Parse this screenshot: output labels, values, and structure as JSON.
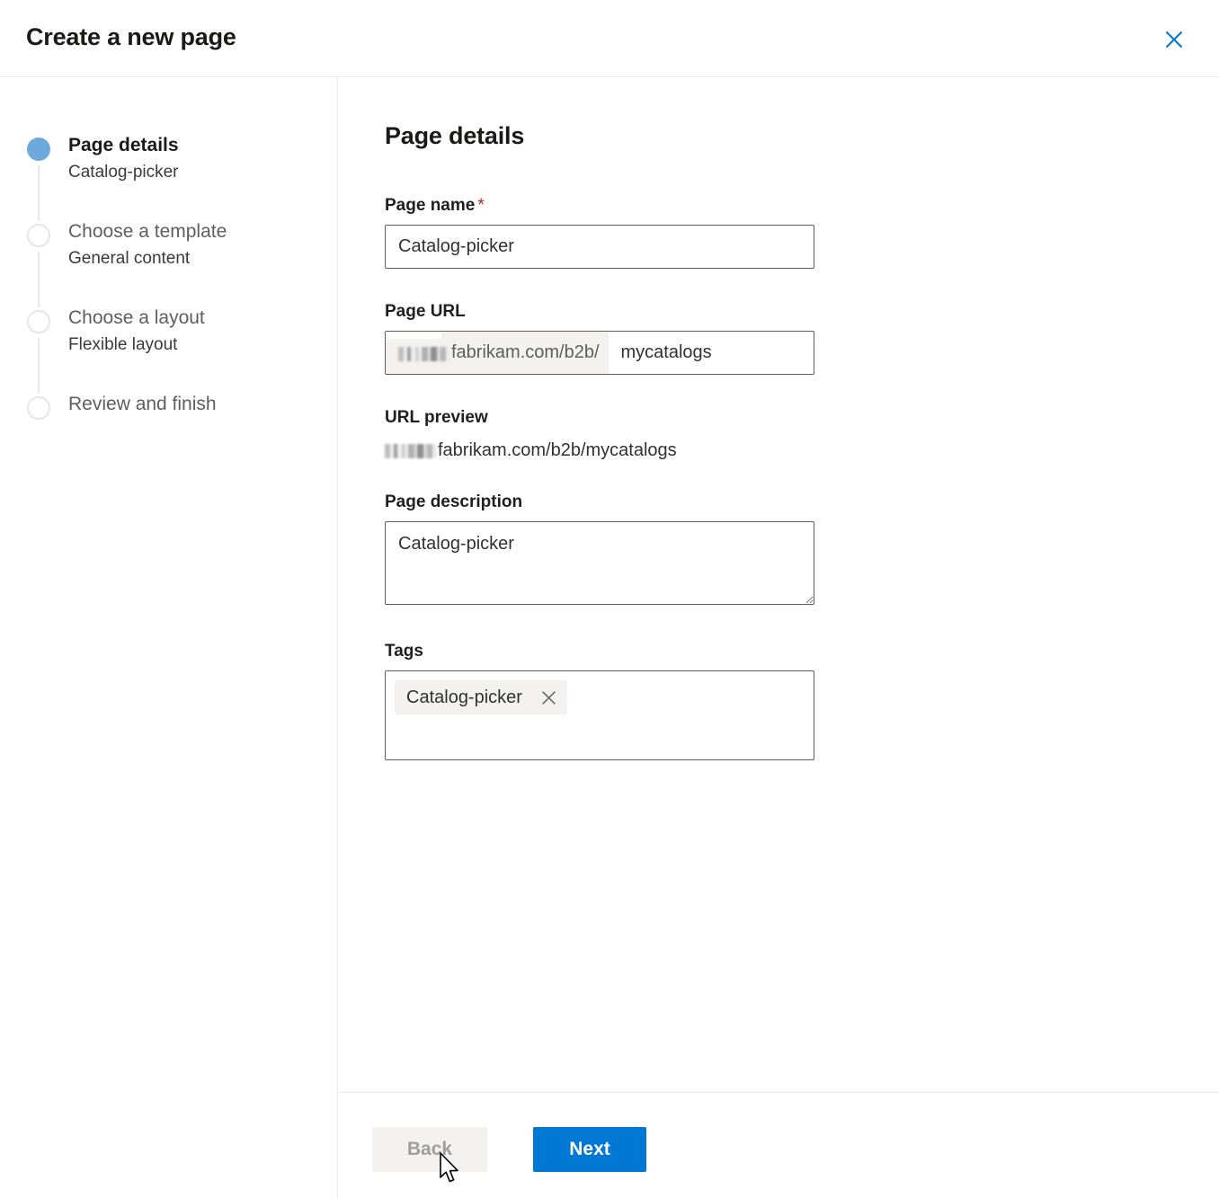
{
  "header": {
    "title": "Create a new page",
    "close_icon": "close-icon",
    "close_color": "#0078d4"
  },
  "sidebar": {
    "steps": [
      {
        "title": "Page details",
        "subtitle": "Catalog-picker",
        "state": "active"
      },
      {
        "title": "Choose a template",
        "subtitle": "General content",
        "state": "inactive"
      },
      {
        "title": "Choose a layout",
        "subtitle": "Flexible layout",
        "state": "inactive"
      },
      {
        "title": "Review and finish",
        "subtitle": "",
        "state": "inactive"
      }
    ],
    "active_marker_color": "#6caadd",
    "inactive_marker_color": "#e6e6e6"
  },
  "main": {
    "section_title": "Page details",
    "page_name": {
      "label": "Page name",
      "required_marker": "*",
      "value": "Catalog-picker",
      "placeholder": ""
    },
    "page_url": {
      "label": "Page URL",
      "prefix_redacted": "[redacted]",
      "prefix": "fabrikam.com/b2b/",
      "value": "mycatalogs",
      "placeholder": ""
    },
    "url_preview": {
      "label": "URL preview",
      "redacted": "[redacted]",
      "value": "fabrikam.com/b2b/mycatalogs"
    },
    "page_description": {
      "label": "Page description",
      "value": "Catalog-picker",
      "placeholder": ""
    },
    "tags": {
      "label": "Tags",
      "chips": [
        {
          "label": "Catalog-picker",
          "remove_icon": "close-icon"
        }
      ]
    }
  },
  "footer": {
    "back_label": "Back",
    "next_label": "Next",
    "back_disabled": true,
    "next_color": "#0078d4"
  }
}
